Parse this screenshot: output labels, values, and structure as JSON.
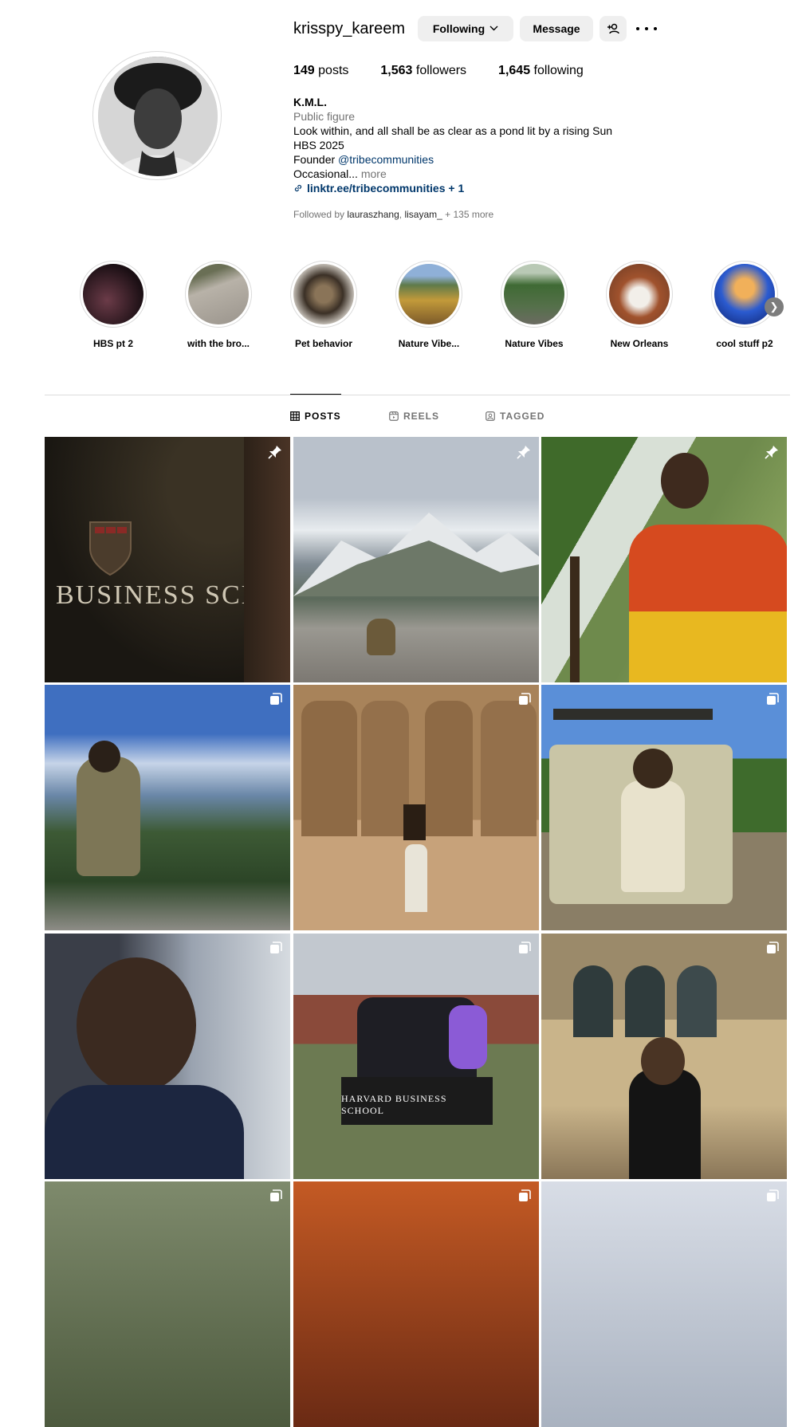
{
  "profile": {
    "username": "krisspy_kareem",
    "following_label": "Following",
    "message_label": "Message",
    "stats": {
      "posts_count": "149",
      "posts_label": "posts",
      "followers_count": "1,563",
      "followers_label": "followers",
      "following_count": "1,645",
      "following_label": "following"
    },
    "bio": {
      "name": "K.M.L.",
      "category": "Public figure",
      "line1": "Look within, and all shall be as clear as a pond lit by a rising Sun",
      "line2": "HBS 2025",
      "founder_prefix": "Founder ",
      "founder_link": "@tribecommunities",
      "line4": "Occasional...",
      "more": "more",
      "external_link": "linktr.ee/tribecommunities + 1"
    },
    "followed_by": {
      "prefix": "Followed by ",
      "user1": "lauraszhang",
      "sep": ", ",
      "user2": "lisayam_",
      "suffix": " + 135 more"
    }
  },
  "highlights": [
    {
      "label": "HBS pt 2",
      "color": "#3a1f2a"
    },
    {
      "label": "with the bro...",
      "color": "#a7a29a"
    },
    {
      "label": "Pet behavior",
      "color": "#6a5a48"
    },
    {
      "label": "Nature Vibe...",
      "color": "#8a7a3a"
    },
    {
      "label": "Nature Vibes",
      "color": "#4f6e45"
    },
    {
      "label": "New Orleans",
      "color": "#a07a66"
    },
    {
      "label": "cool stuff p2",
      "color": "#2c4fb0"
    }
  ],
  "tabs": {
    "posts": "POSTS",
    "reels": "REELS",
    "tagged": "TAGGED"
  },
  "posts": {
    "p1_sign_text": "BUSINESS SCH",
    "p8_sign_text": "HARVARD BUSINESS SCHOOL"
  }
}
